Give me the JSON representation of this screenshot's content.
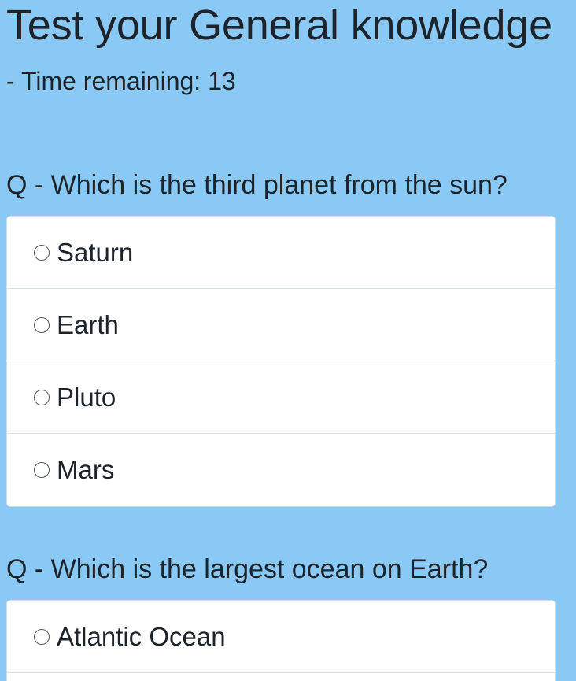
{
  "header": {
    "title": "Test your General knowledge",
    "timer_text": "- Time remaining: 13"
  },
  "questions": [
    {
      "text": "Q - Which is the third planet from the sun?",
      "options": [
        "Saturn",
        "Earth",
        "Pluto",
        "Mars"
      ]
    },
    {
      "text": "Q - Which is the largest ocean on Earth?",
      "options": [
        "Atlantic Ocean"
      ]
    }
  ],
  "colors": {
    "background": "#89c9f4",
    "card": "#ffffff",
    "text": "#1d232b"
  }
}
